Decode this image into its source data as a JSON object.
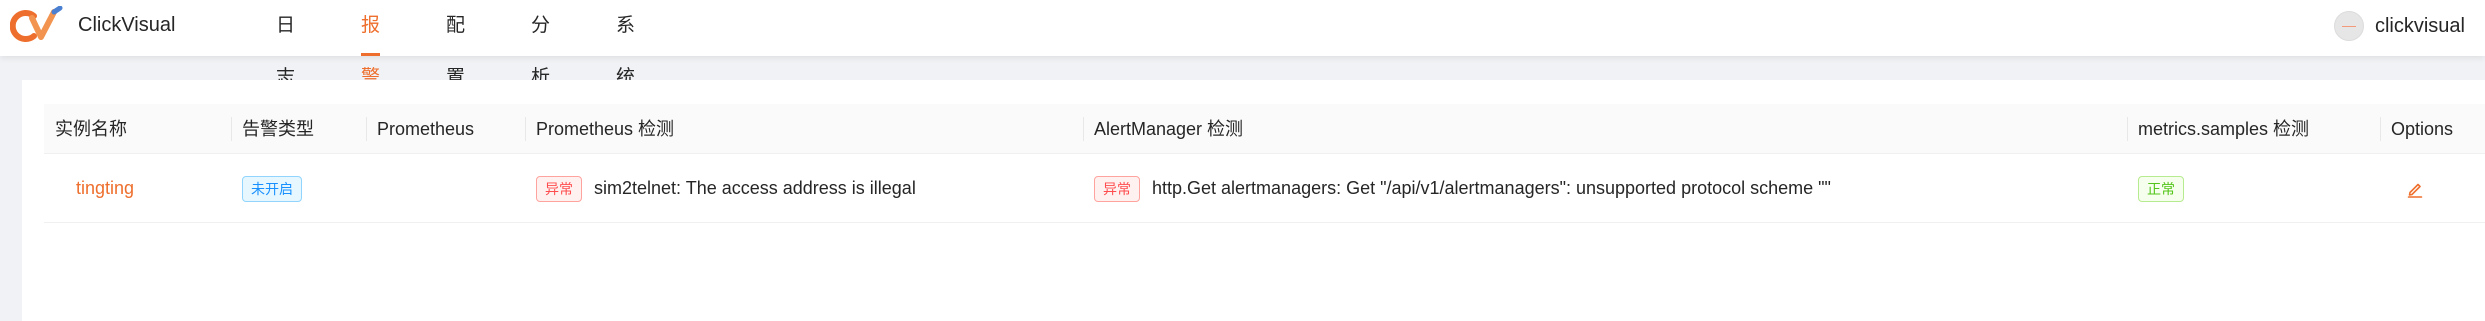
{
  "header": {
    "brand": "ClickVisual",
    "nav": [
      "日志",
      "报警",
      "配置",
      "分析",
      "系统管理"
    ],
    "active_nav": "报警",
    "user": "clickvisual",
    "accent": "#ee6f2d"
  },
  "table": {
    "columns": [
      "实例名称",
      "告警类型",
      "Prometheus",
      "Prometheus 检测",
      "AlertManager 检测",
      "metrics.samples 检测",
      "Options"
    ],
    "rows": [
      {
        "name": "tingting",
        "alert_type": "未开启",
        "prometheus": "",
        "prometheus_check_status": "异常",
        "prometheus_check_msg": "sim2telnet: The access address is illegal",
        "alertmanager_check_status": "异常",
        "alertmanager_check_msg": "http.Get alertmanagers: Get \"/api/v1/alertmanagers\": unsupported protocol scheme \"\"",
        "metrics_samples_status": "正常",
        "options_icon": "edit-icon"
      }
    ]
  }
}
